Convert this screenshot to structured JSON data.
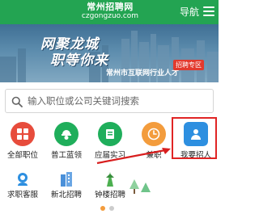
{
  "header": {
    "logo_cn": "常州招聘网",
    "logo_en": "czgongzuo.com",
    "nav_label": "导航",
    "bg_color": "#23a452"
  },
  "banner": {
    "title_line1": "网聚龙城",
    "title_line2": "职等你来",
    "subtitle": "常州市互联网行业人才",
    "tag": "招聘专区",
    "tag_color": "#e23a2e"
  },
  "search": {
    "placeholder": "输入职位或公司关键词搜索",
    "icon": "search-icon"
  },
  "grid_row1": [
    {
      "label": "全部职位",
      "icon": "grid-icon",
      "color": "#e74c3c"
    },
    {
      "label": "普工蓝领",
      "icon": "worker-icon",
      "color": "#1fae5b"
    },
    {
      "label": "应届实习",
      "icon": "graduate-icon",
      "color": "#1fae5b"
    },
    {
      "label": "兼职",
      "icon": "clock-icon",
      "color": "#f39c3d"
    },
    {
      "label": "我要招人",
      "icon": "recruiter-icon",
      "color": "#2d8fe0"
    }
  ],
  "grid_row2": [
    {
      "label": "求职客服",
      "icon": "customer-service-icon",
      "color": "#2d8fe0"
    },
    {
      "label": "新北招聘",
      "icon": "building-icon",
      "color": "#4a90d9"
    },
    {
      "label": "钟楼招聘",
      "icon": "tower-icon",
      "color": "#4caf50"
    }
  ],
  "highlight_color": "#e02424",
  "carousel": {
    "dot_active_color": "#f39c3d",
    "dot_inactive_color": "#cccccc"
  }
}
